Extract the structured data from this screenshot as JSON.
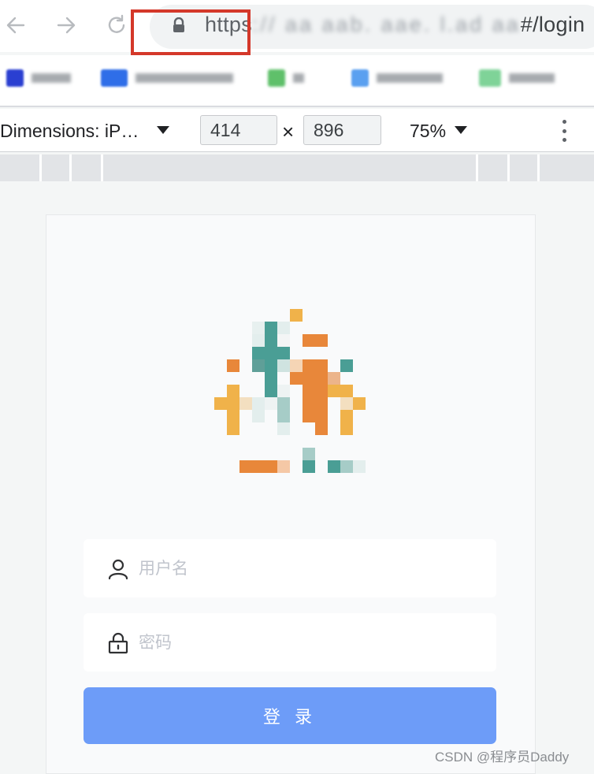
{
  "browser": {
    "url": {
      "protocol": "https",
      "host_obscured": ":// aa aab. aae. l.ad aa",
      "path": "#/login"
    },
    "nav_icons": [
      "back-arrow-icon",
      "forward-arrow-icon",
      "reload-icon"
    ],
    "highlight_color": "#d4382a"
  },
  "devtools": {
    "dimensions_label": "Dimensions: iP…",
    "width": "414",
    "height": "896",
    "times": "×",
    "zoom": "75%"
  },
  "login": {
    "username_placeholder": "用户名",
    "password_placeholder": "密码",
    "submit_label": "登 录",
    "button_color": "#6d9cf8"
  },
  "watermark": "CSDN @程序员Daddy"
}
